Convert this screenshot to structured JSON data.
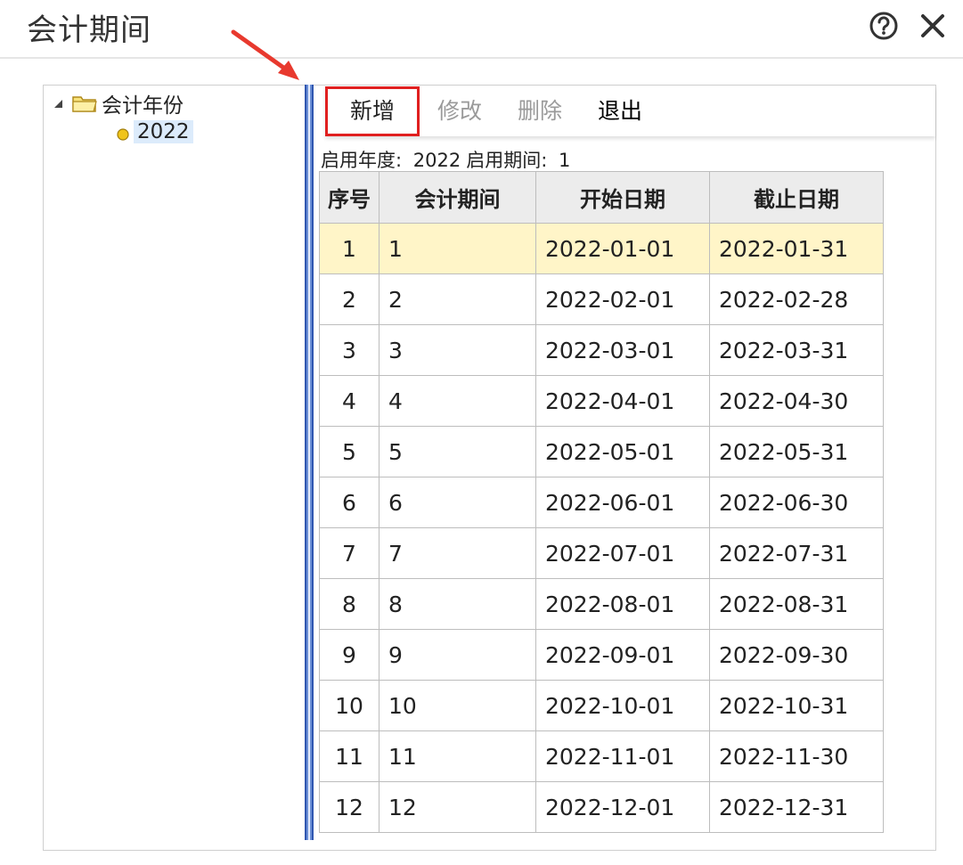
{
  "window": {
    "title": "会计期间"
  },
  "tree": {
    "root_label": "会计年份",
    "child_label": "2022"
  },
  "toolbar": {
    "add": "新增",
    "edit": "修改",
    "delete": "删除",
    "exit": "退出"
  },
  "info": {
    "year_label": "启用年度:",
    "year_value": "2022",
    "period_label": "启用期间:",
    "period_value": "1"
  },
  "table": {
    "headers": [
      "序号",
      "会计期间",
      "开始日期",
      "截止日期"
    ],
    "rows": [
      [
        "1",
        "1",
        "2022-01-01",
        "2022-01-31"
      ],
      [
        "2",
        "2",
        "2022-02-01",
        "2022-02-28"
      ],
      [
        "3",
        "3",
        "2022-03-01",
        "2022-03-31"
      ],
      [
        "4",
        "4",
        "2022-04-01",
        "2022-04-30"
      ],
      [
        "5",
        "5",
        "2022-05-01",
        "2022-05-31"
      ],
      [
        "6",
        "6",
        "2022-06-01",
        "2022-06-30"
      ],
      [
        "7",
        "7",
        "2022-07-01",
        "2022-07-31"
      ],
      [
        "8",
        "8",
        "2022-08-01",
        "2022-08-31"
      ],
      [
        "9",
        "9",
        "2022-09-01",
        "2022-09-30"
      ],
      [
        "10",
        "10",
        "2022-10-01",
        "2022-10-31"
      ],
      [
        "11",
        "11",
        "2022-11-01",
        "2022-11-30"
      ],
      [
        "12",
        "12",
        "2022-12-01",
        "2022-12-31"
      ]
    ]
  },
  "icons": {
    "help": "help-circle-icon",
    "close": "close-icon",
    "folder": "folder-icon",
    "expand": "expand-triangle-icon",
    "node": "tree-node-dot-icon"
  },
  "colors": {
    "selected_row": "#fff5c8",
    "highlight_border": "#e02020",
    "splitter": "#6b8fd6"
  }
}
